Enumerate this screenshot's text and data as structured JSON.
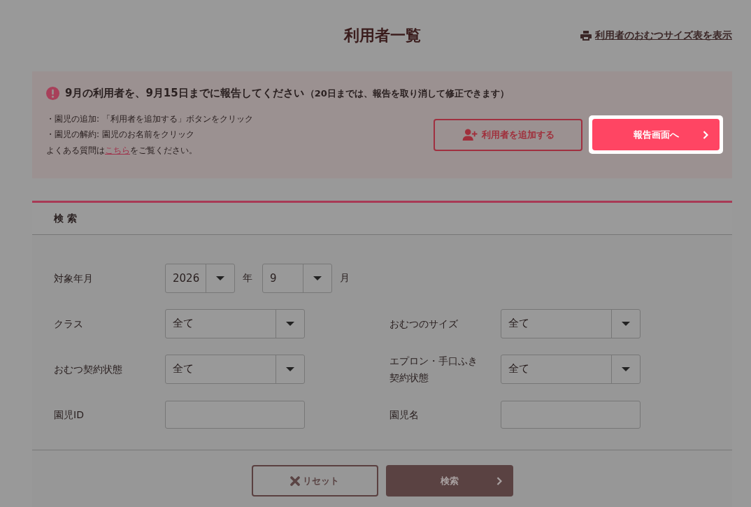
{
  "page": {
    "title": "利用者一覧",
    "print_link": "利用者のおむつサイズ表を表示"
  },
  "notice": {
    "headline": "9月の利用者を、9月15日までに報告してください",
    "headline_note": "（20日までは、報告を取り消して修正できます）",
    "lines": [
      "・園児の追加: 「利用者を追加する」ボタンをクリック",
      "・園児の解約: 園児のお名前をクリック"
    ],
    "faq": {
      "before": "よくある質問は",
      "link": "こちら",
      "after": "をご覧ください。"
    },
    "buttons": [
      {
        "label": "利用者を追加する",
        "kind": "add",
        "highlighted": false
      },
      {
        "label": "報告画面へ",
        "kind": "next",
        "highlighted": true
      }
    ]
  },
  "search": {
    "title": "検 索",
    "rows": [
      [
        {
          "label": "対象年月",
          "kind": "year_month",
          "year": "2026",
          "year_unit": "年",
          "month": "9",
          "month_unit": "月"
        }
      ],
      [
        {
          "label": "クラス",
          "kind": "select",
          "value": "全て"
        },
        {
          "label": "おむつのサイズ",
          "kind": "select",
          "value": "全て"
        }
      ],
      [
        {
          "label": "おむつ契約状態",
          "kind": "select",
          "value": "全て"
        },
        {
          "label": "エプロン・手口ふき契約状態",
          "kind": "select",
          "value": "全て"
        }
      ],
      [
        {
          "label": "園児ID",
          "kind": "text"
        },
        {
          "label": "園児名",
          "kind": "text"
        }
      ]
    ],
    "buttons": [
      {
        "label": "リセット",
        "kind": "reset"
      },
      {
        "label": "検索",
        "kind": "submit"
      }
    ]
  }
}
